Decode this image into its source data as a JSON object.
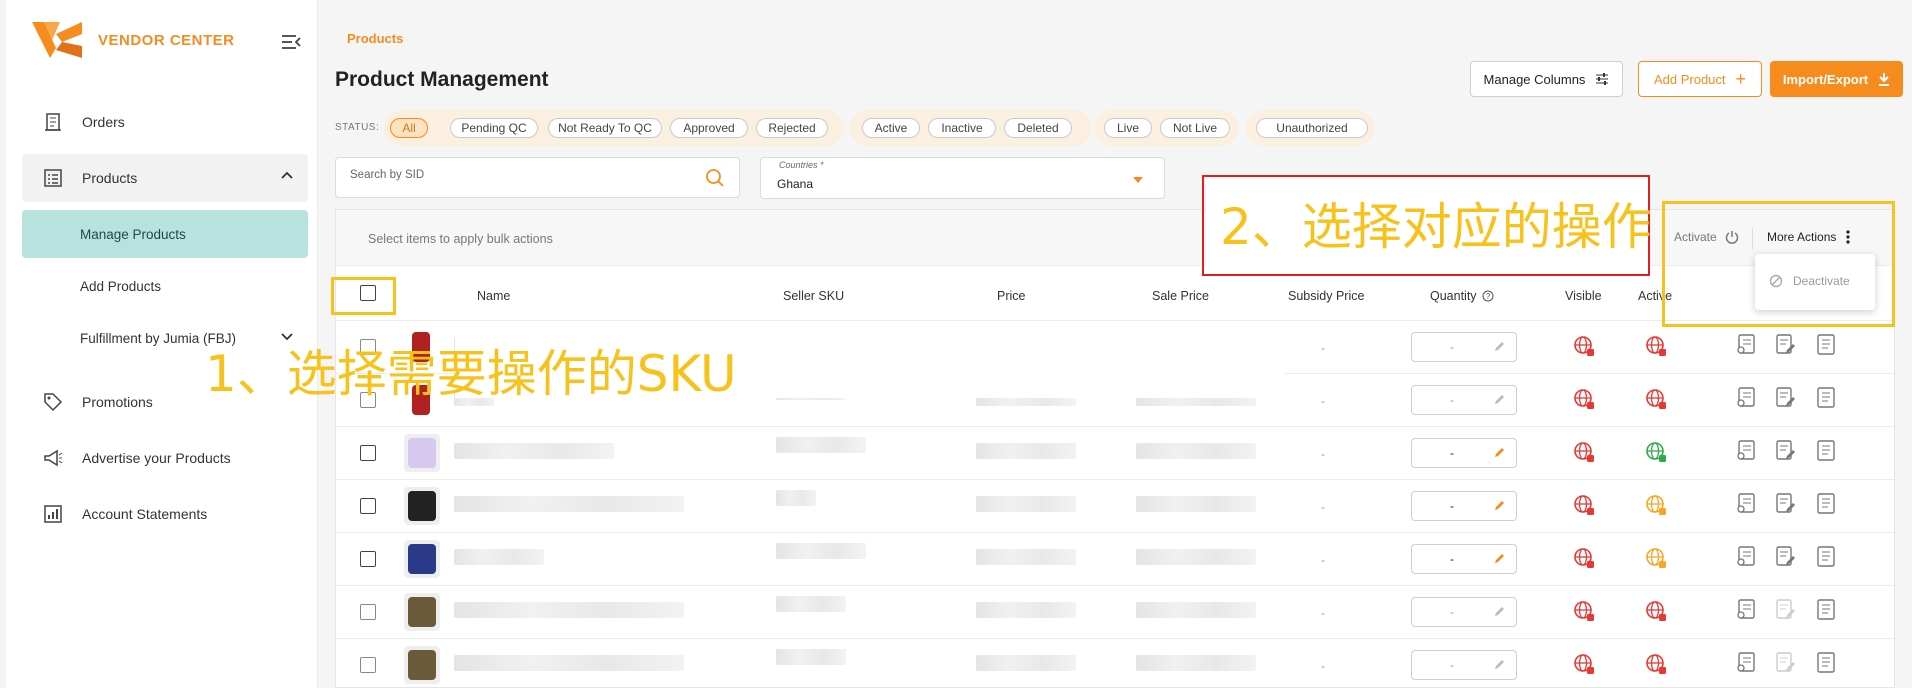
{
  "sidebar": {
    "logo_text": "VENDOR CENTER",
    "items": [
      {
        "label": "Orders"
      },
      {
        "label": "Products"
      },
      {
        "label": "Manage Products"
      },
      {
        "label": "Add Products"
      },
      {
        "label": "Fulfillment by Jumia (FBJ)"
      },
      {
        "label": "Promotions"
      },
      {
        "label": "Advertise your Products"
      },
      {
        "label": "Account Statements"
      }
    ]
  },
  "header": {
    "breadcrumb": "Products",
    "title": "Product Management",
    "buttons": {
      "manage_columns": "Manage Columns",
      "add_product": "Add Product",
      "import_export": "Import/Export"
    }
  },
  "filters": {
    "status_label": "STATUS:",
    "chips": [
      "All",
      "Pending QC",
      "Not Ready To QC",
      "Approved",
      "Rejected",
      "Active",
      "Inactive",
      "Deleted",
      "Live",
      "Not Live",
      "Unauthorized"
    ],
    "selected": "All",
    "search_placeholder": "Search by SID",
    "country_label": "Countries *",
    "country_value": "Ghana"
  },
  "bulk": {
    "hint": "Select items to apply bulk actions",
    "activate": "Activate",
    "more_actions": "More Actions",
    "menu": [
      "Deactivate"
    ]
  },
  "table": {
    "columns": [
      "Name",
      "Seller SKU",
      "Price",
      "Sale Price",
      "Subsidy Price",
      "Quantity",
      "Visible",
      "Active"
    ],
    "rows": [
      {
        "subsidy": "-",
        "quantity": "-",
        "visible": "red",
        "active": "red"
      },
      {
        "subsidy": "-",
        "quantity": "-",
        "visible": "red",
        "active": "red"
      },
      {
        "subsidy": "-",
        "quantity": "-",
        "visible": "red",
        "active": "green"
      },
      {
        "subsidy": "-",
        "quantity": "-",
        "visible": "red",
        "active": "orange"
      },
      {
        "subsidy": "-",
        "quantity": "-",
        "visible": "red",
        "active": "orange"
      },
      {
        "subsidy": "-",
        "quantity": "-",
        "visible": "red",
        "active": "red"
      },
      {
        "subsidy": "-",
        "quantity": "-",
        "visible": "red",
        "active": "red"
      }
    ]
  },
  "annotations": {
    "step1": "1、选择需要操作的SKU",
    "step2": "2、选择对应的操作"
  },
  "colors": {
    "accent": "#f68b1e",
    "selected_nav": "#b8e2de",
    "highlight": "#f7c21c",
    "red_box": "#e02020"
  }
}
